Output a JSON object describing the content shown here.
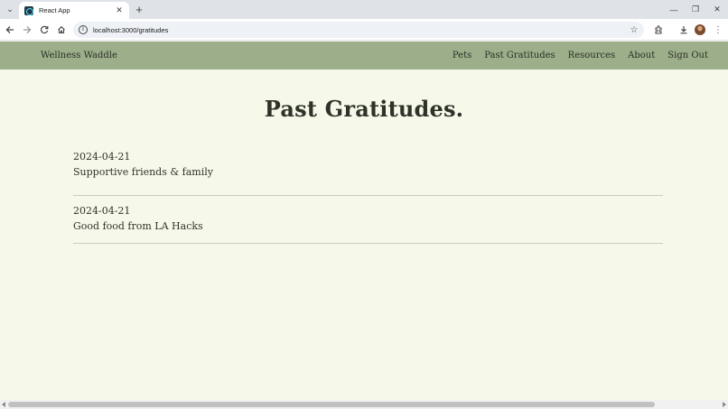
{
  "browser": {
    "tab_title": "React App",
    "url": "localhost:3000/gratitudes"
  },
  "app": {
    "brand": "Wellness Waddle",
    "nav": [
      "Pets",
      "Past Gratitudes",
      "Resources",
      "About",
      "Sign Out"
    ],
    "page_title": "Past Gratitudes.",
    "entries": [
      {
        "date": "2024-04-21",
        "text": "Supportive friends & family"
      },
      {
        "date": "2024-04-21",
        "text": "Good food from LA Hacks"
      }
    ]
  },
  "colors": {
    "nav_bg": "#9cae8a",
    "page_bg": "#f6f9ea",
    "text": "#2e3229"
  }
}
